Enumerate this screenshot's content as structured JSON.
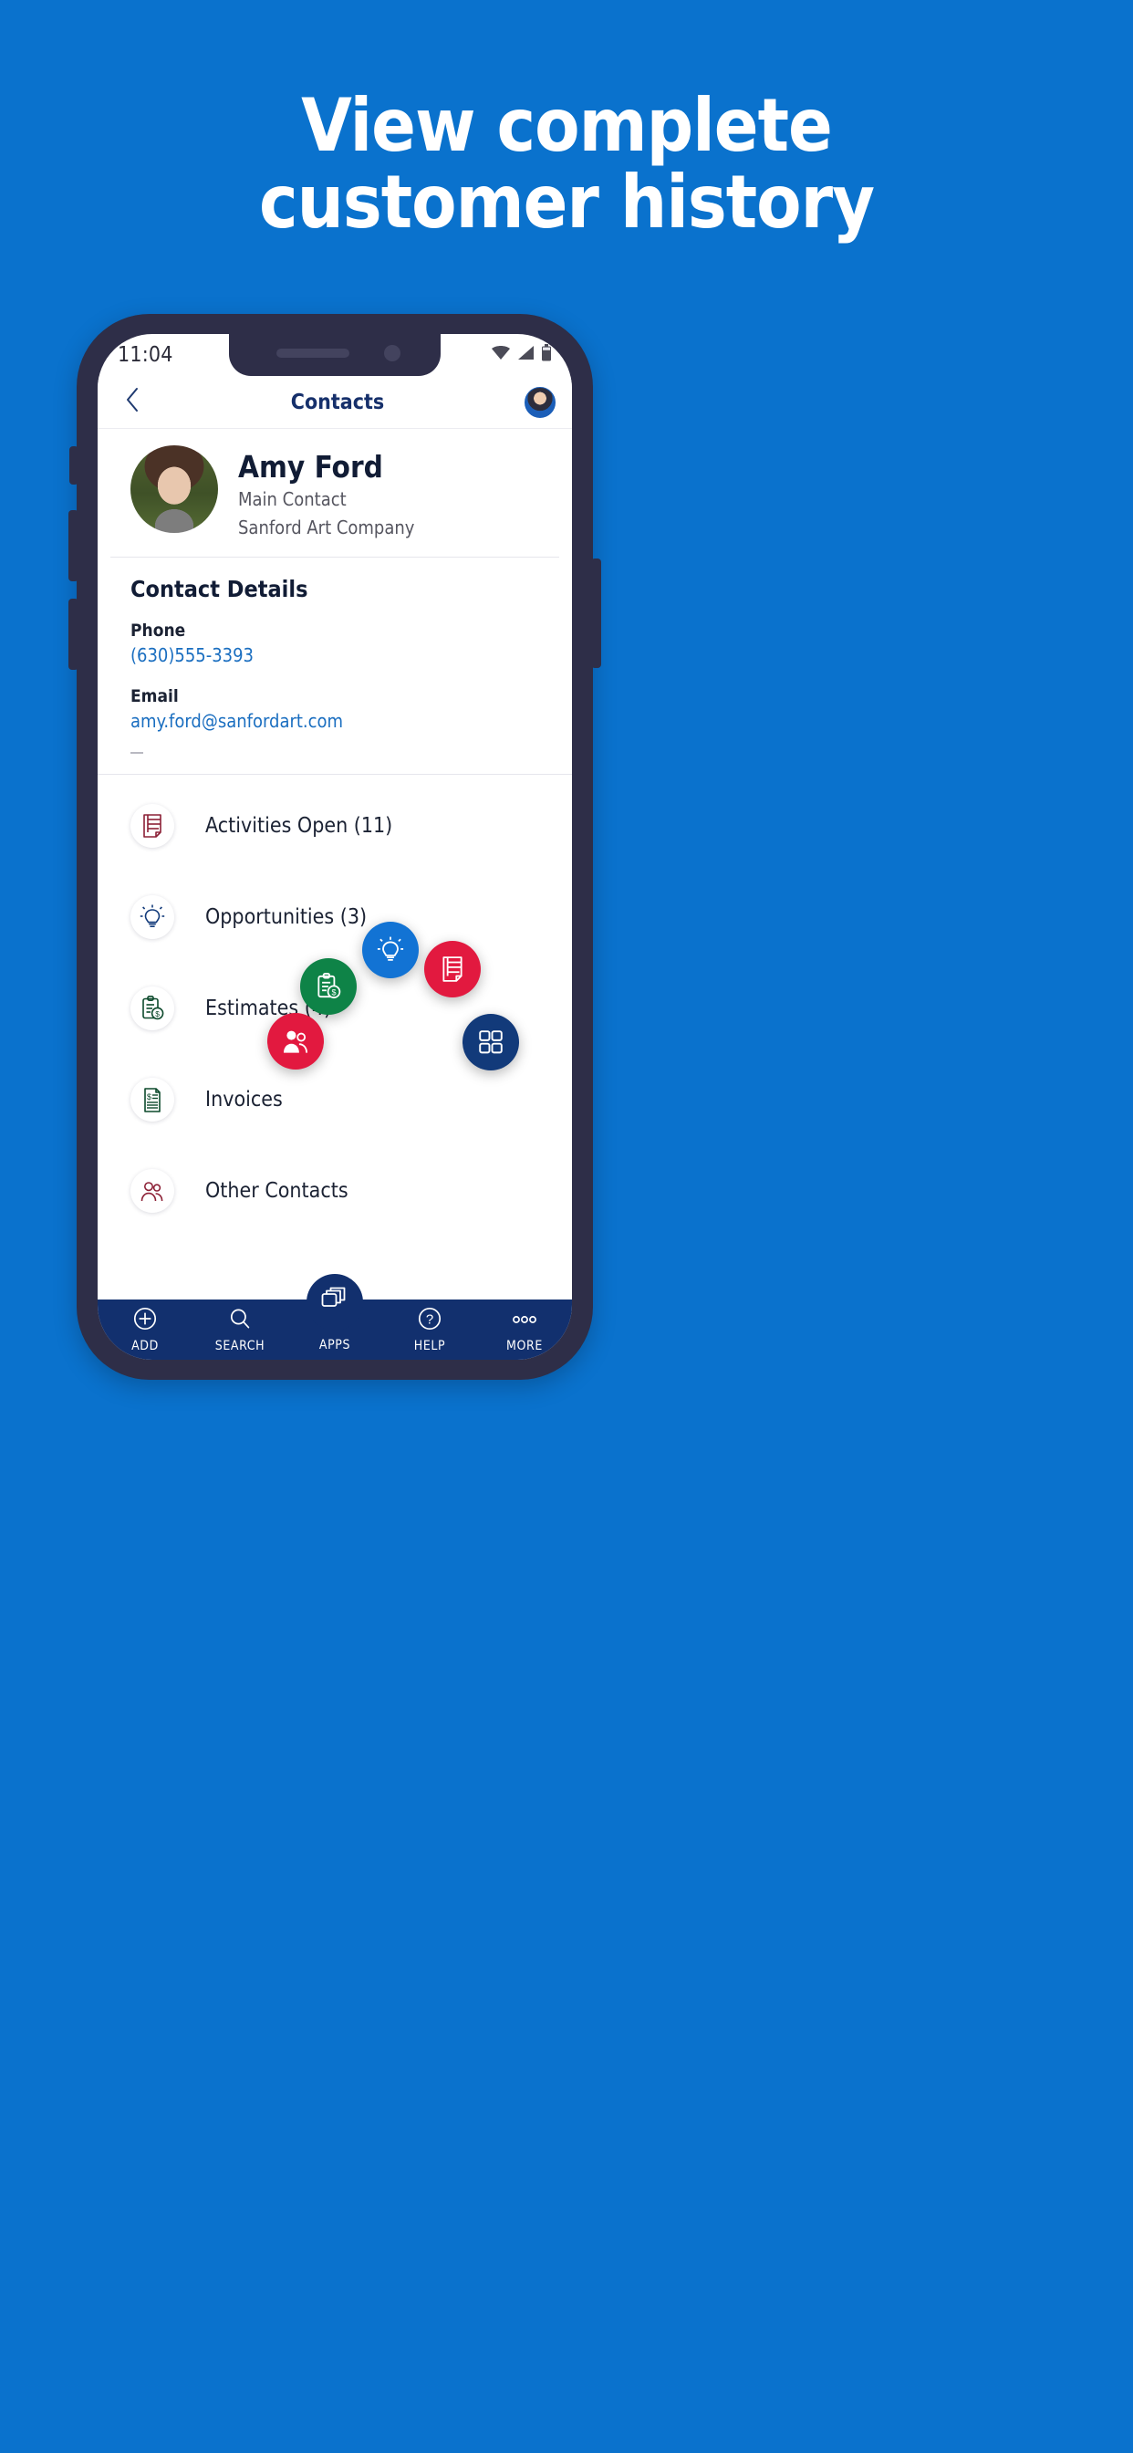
{
  "promo": {
    "headline_line1": "View complete",
    "headline_line2": "customer history",
    "background_color": "#0a72cd",
    "headline_color": "#ffffff"
  },
  "phone": {
    "status_bar": {
      "time": "11:04",
      "icons": [
        "wifi-icon",
        "signal-icon",
        "battery-icon"
      ]
    },
    "nav": {
      "back_icon": "chevron-left-icon",
      "title": "Contacts",
      "avatar_icon": "user-avatar-icon"
    },
    "contact": {
      "avatar_icon": "contact-photo",
      "name": "Amy Ford",
      "role": "Main Contact",
      "company": "Sanford Art Company"
    },
    "details": {
      "section_title": "Contact Details",
      "fields": [
        {
          "label": "Phone",
          "value": "(630)555-3393",
          "icon": "phone-link",
          "color": "#1a6ec0"
        },
        {
          "label": "Email",
          "value": "amy.ford@sanfordart.com",
          "icon": "email-link",
          "color": "#1a6ec0"
        }
      ]
    },
    "rows": [
      {
        "label": "Activities Open (11)",
        "icon": "notepad-icon",
        "color": "#8c2036"
      },
      {
        "label": "Opportunities (3)",
        "icon": "lightbulb-icon",
        "color": "#123a7a"
      },
      {
        "label": "Estimates (4)",
        "icon": "clipboard-dollar-icon",
        "color": "#0d4a2c"
      },
      {
        "label": "Invoices",
        "icon": "invoice-icon",
        "color": "#0d4a2c"
      },
      {
        "label": "Other Contacts",
        "icon": "people-icon",
        "color": "#8c2036"
      }
    ],
    "bubbles": [
      {
        "icon": "clipboard-dollar-icon",
        "color": "#0e8347"
      },
      {
        "icon": "lightbulb-icon",
        "color": "#1273d4"
      },
      {
        "icon": "notepad-icon",
        "color": "#e2193f"
      },
      {
        "icon": "people-icon",
        "color": "#e2193f"
      },
      {
        "icon": "grid-icon",
        "color": "#123a7a"
      }
    ],
    "bottom_nav": [
      {
        "label": "ADD",
        "icon": "plus-circle-icon"
      },
      {
        "label": "SEARCH",
        "icon": "search-icon"
      },
      {
        "label": "APPS",
        "icon": "apps-stack-icon"
      },
      {
        "label": "HELP",
        "icon": "question-circle-icon"
      },
      {
        "label": "MORE",
        "icon": "ellipsis-icon"
      }
    ],
    "bottom_nav_color": "#12306e"
  }
}
